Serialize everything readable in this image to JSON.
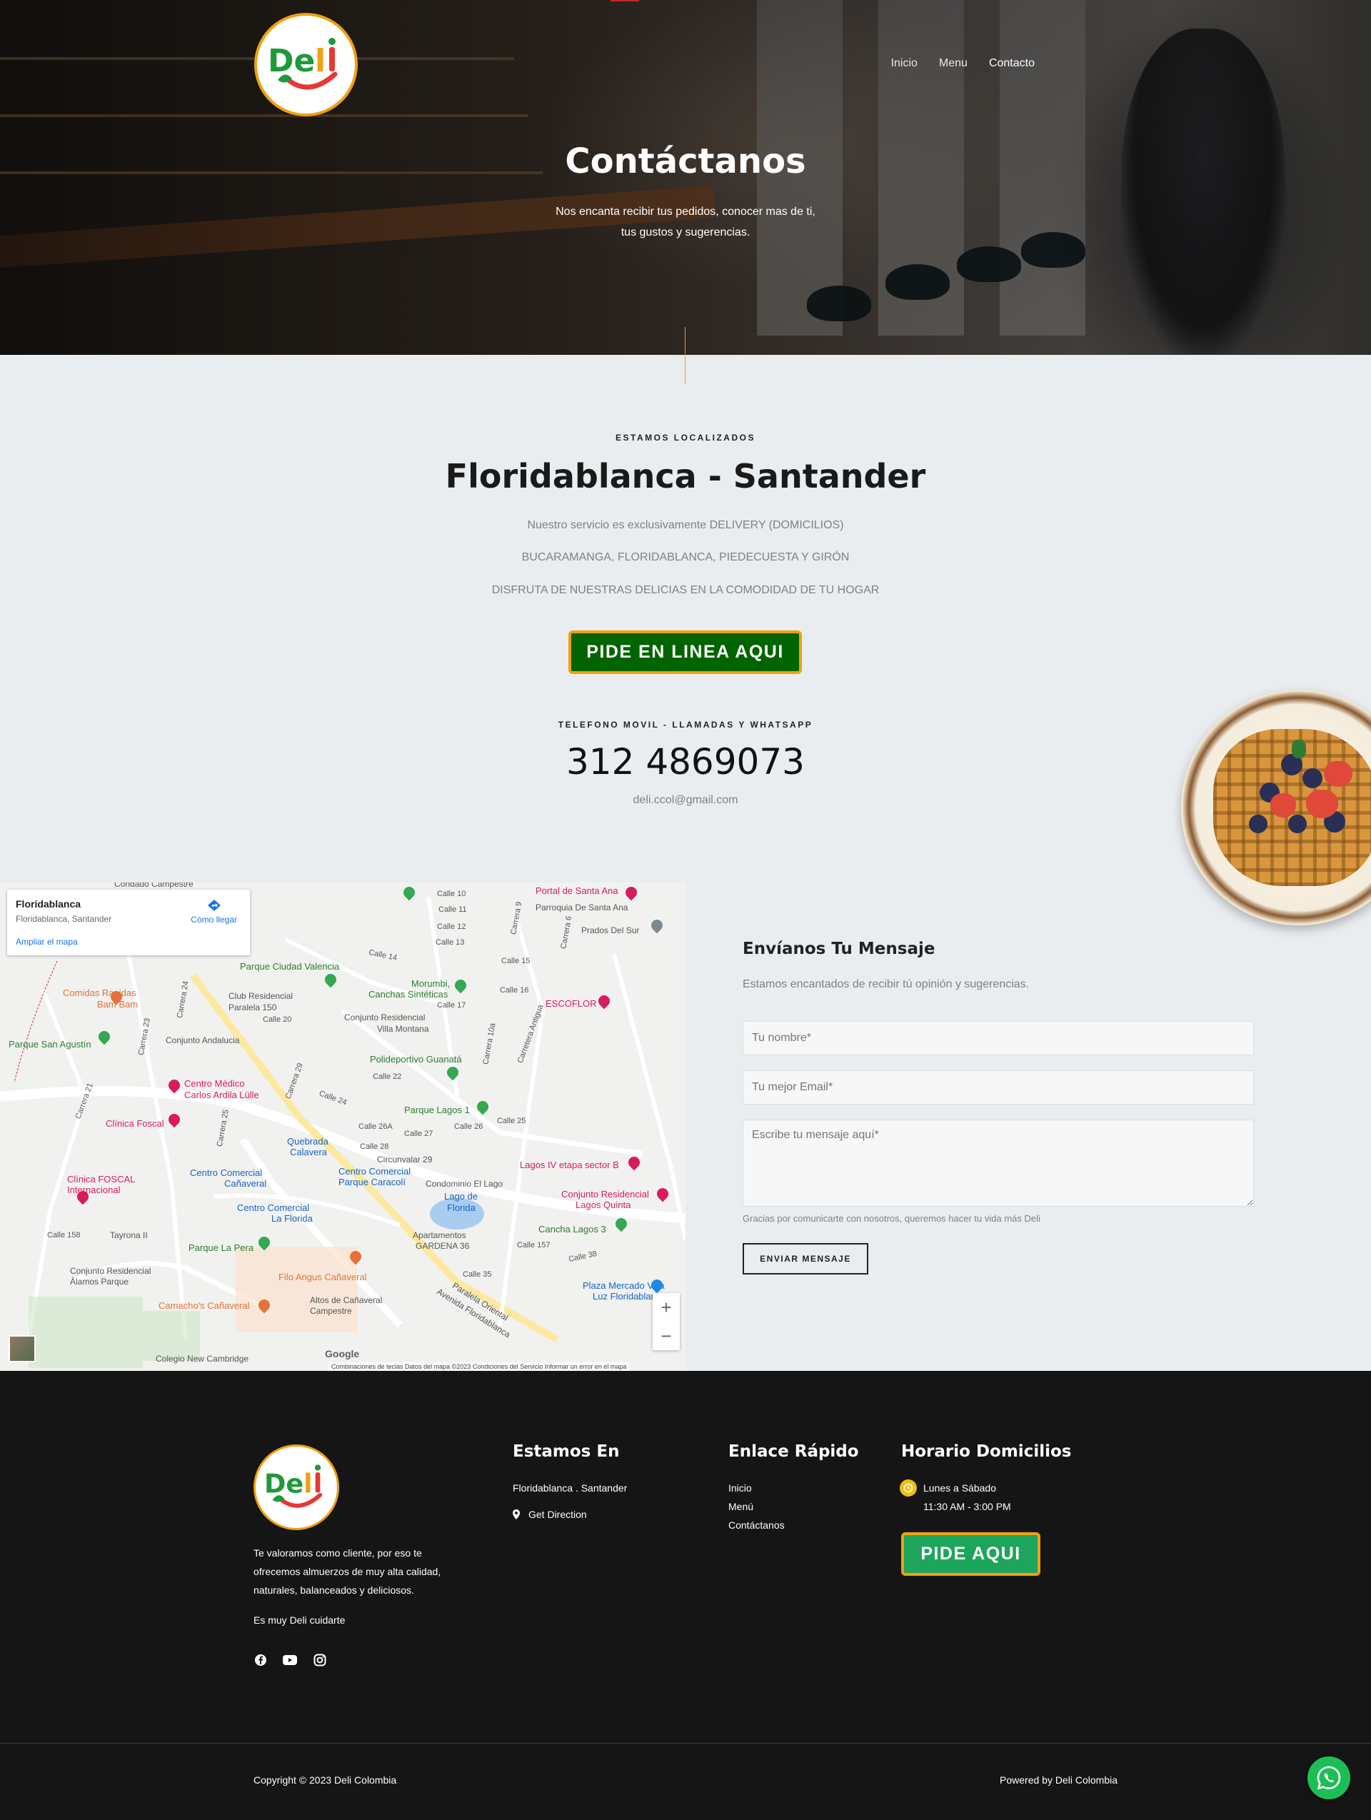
{
  "brand": {
    "logo_text": "Deli",
    "accent": "#f0a010",
    "green": "#006400"
  },
  "nav": {
    "items": [
      "Inicio",
      "Menu",
      "Contacto"
    ],
    "active": "Contacto"
  },
  "hero": {
    "title": "Contáctanos",
    "subtitle_line1": "Nos encanta recibir tus pedidos, conocer mas de ti,",
    "subtitle_line2": "tus gustos y sugerencias."
  },
  "location": {
    "eyebrow": "ESTAMOS LOCALIZADOS",
    "title": "Floridablanca - Santander",
    "line1": "Nuestro servicio es exclusivamente DELIVERY (DOMICILIOS)",
    "line2": "BUCARAMANGA, FLORIDABLANCA, PIEDECUESTA Y GIRÓN",
    "line3": "DISFRUTA DE NUESTRAS DELICIAS EN LA COMODIDAD DE TU HOGAR",
    "cta": "PIDE EN LINEA AQUI"
  },
  "phone": {
    "eyebrow": "TELEFONO MOVIL - LLAMADAS Y WHATSAPP",
    "number": "312 4869073",
    "email": "deli.ccol@gmail.com"
  },
  "map": {
    "card_title": "Floridablanca",
    "card_sub": "Floridablanca, Santander",
    "card_link": "Ampliar el mapa",
    "directions": "Cómo llegar",
    "places": {
      "parque_ciudad_valencia": "Parque Ciudad Valencia",
      "morumbi": "Morumbi,",
      "canchas": "Canchas Sintéticas",
      "portal": "Portal de Santa Ana",
      "parroquia": "Parroquia De Santa Ana",
      "prados": "Prados Del Sur",
      "comidas": "Comidas Rapidas",
      "bam": "Bam Bam",
      "club": "Club Residencial",
      "paralela": "Paralela 150",
      "conjunto_villa": "Conjunto Residencial",
      "villa_montana": "Villa Montana",
      "escoflor": "ESCOFLOR",
      "parque_san_agustin": "Parque San Agustín",
      "conjunto_andalucia": "Conjunto Andalucia",
      "polideportivo": "Polideportivo Guanatá",
      "centro_medico": "Centro Médico",
      "carlos": "Carlos Ardila Lülle",
      "parque_lagos": "Parque Lagos 1",
      "clinica_foscal": "Clínica Foscal",
      "quebrada": "Quebrada",
      "calavera": "Calavera",
      "circunvalar": "Circunvalar 29",
      "lagos_iv": "Lagos IV etapa sector B",
      "clinica_foscal_int": "Clínica FOSCAL",
      "internacional": "Internacional",
      "cc_canaveral": "Centro Comercial",
      "canaveral": "Cañaveral",
      "cc_caracoli": "Centro Comercial",
      "parque_caracoli": "Parque Caracolí",
      "condominio": "Condominio El Lago",
      "lago": "Lago de",
      "florida": "Florida",
      "conjunto_lagos": "Conjunto Residencial",
      "lagos_quinta": "Lagos Quinta",
      "cc_la_florida": "Centro Comercial",
      "la_florida": "La Florida",
      "cancha_lagos": "Cancha Lagos 3",
      "tayrona": "Tayrona II",
      "apartamentos": "Apartamentos",
      "gardena": "GARDENA 36",
      "parque_la_pera": "Parque La Pera",
      "conjunto_alamos": "Conjunto Residencial",
      "alamos": "Álamos Parque",
      "filo": "Filo Angus Cañaveral",
      "plaza": "Plaza Mercado Villa",
      "luz": "Luz Floridablanca",
      "camachos": "Camacho's Cañaveral",
      "altos": "Altos de Cañaveral",
      "campestre": "Campestre",
      "paralela_oriental": "Paralela Oriental",
      "avenida": "Avenida Floridablanca",
      "colegio": "Colegio New Cambridge",
      "condado": "Condado Campestre"
    },
    "streets": [
      "Calle 10",
      "Calle 11",
      "Calle 12",
      "Calle 13",
      "Calle 14",
      "Calle 15",
      "Calle 16",
      "Calle 17",
      "Calle 20",
      "Calle 22",
      "Calle 24",
      "Calle 25",
      "Calle 26",
      "Calle 26A",
      "Calle 27",
      "Calle 28",
      "Calle 35",
      "Calle 38",
      "Calle 157",
      "Calle 158",
      "Carrera 9",
      "Carrera 6",
      "Carrera 21",
      "Carrera 23",
      "Carrera 24",
      "Carrera 25",
      "Carrera 29",
      "Carrera 10a",
      "Carretera Antigua"
    ],
    "google": "Google",
    "footer": "Combinaciones de teclas    Datos del mapa ©2023    Condiciones del Servicio    Informar un error en el mapa",
    "zoom_in": "+",
    "zoom_out": "−"
  },
  "form": {
    "title": "Envíanos Tu Mensaje",
    "subtitle": "Estamos encantados de recibir tú opinión y sugerencias.",
    "name_placeholder": "Tu nombre*",
    "email_placeholder": "Tu mejor Email*",
    "message_placeholder": "Escribe tu mensaje aquí*",
    "note": "Gracias por comunicarte con nosotros, queremos hacer tu vida más Deli",
    "submit": "ENVIAR MENSAJE"
  },
  "footer": {
    "about_line1": "Te valoramos como cliente, por eso te",
    "about_line2": "ofrecemos almuerzos de muy alta calidad,",
    "about_line3": "naturales, balanceados y deliciosos.",
    "tagline": "Es muy Deli cuidarte",
    "col2_title": "Estamos En",
    "col2_address": "Floridablanca . Santander",
    "col2_direction": "Get Direction",
    "col3_title": "Enlace Rápido",
    "col3_links": [
      "Inicio",
      "Menú",
      "Contáctanos"
    ],
    "col4_title": "Horario Domicilios",
    "col4_days": "Lunes a Sábado",
    "col4_hours": "11:30 AM - 3:00 PM",
    "col4_cta": "PIDE AQUI",
    "copyright": "Copyright © 2023 Deli Colombia",
    "powered": "Powered by Deli Colombia",
    "social_icons": [
      "facebook-icon",
      "youtube-icon",
      "instagram-icon"
    ]
  }
}
